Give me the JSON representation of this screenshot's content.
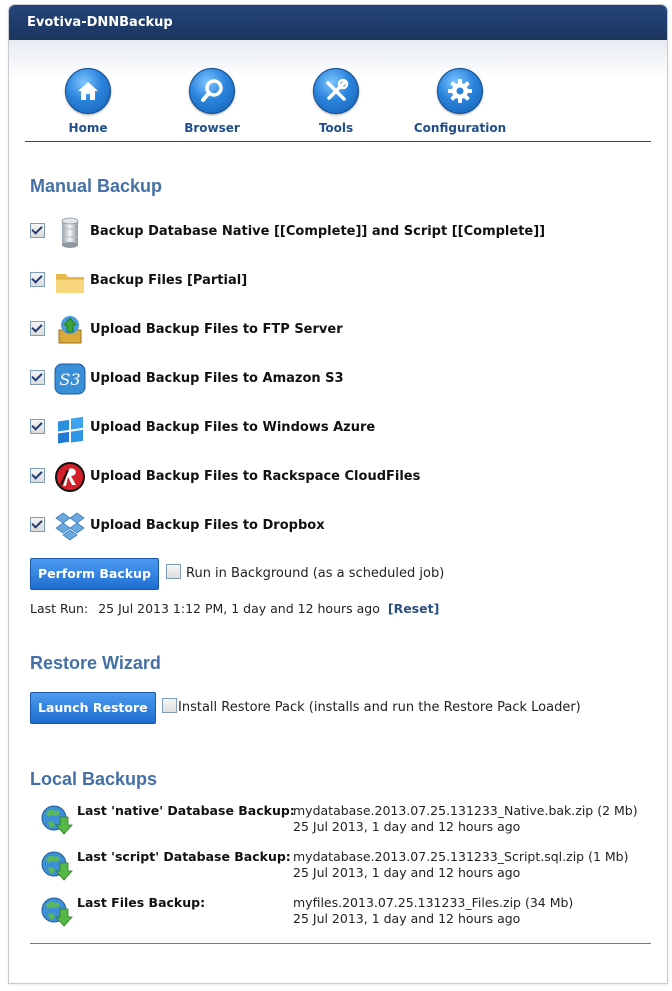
{
  "window": {
    "title": "Evotiva-DNNBackup"
  },
  "nav": [
    {
      "label": "Home",
      "icon": "home-icon"
    },
    {
      "label": "Browser",
      "icon": "magnifier-icon"
    },
    {
      "label": "Tools",
      "icon": "tools-icon"
    },
    {
      "label": "Configuration",
      "icon": "gear-icon"
    }
  ],
  "manual_backup": {
    "title": "Manual Backup",
    "options": [
      {
        "label": "Backup Database Native [[Complete]] and Script [[Complete]]",
        "checked": true,
        "icon": "database-icon"
      },
      {
        "label": "Backup Files [Partial]",
        "checked": true,
        "icon": "folder-icon"
      },
      {
        "label": "Upload Backup Files to FTP Server",
        "checked": true,
        "icon": "ftp-upload-icon"
      },
      {
        "label": "Upload Backup Files to Amazon S3",
        "checked": true,
        "icon": "amazon-s3-icon"
      },
      {
        "label": "Upload Backup Files to Windows Azure",
        "checked": true,
        "icon": "windows-azure-icon"
      },
      {
        "label": "Upload Backup Files to Rackspace CloudFiles",
        "checked": true,
        "icon": "rackspace-icon"
      },
      {
        "label": "Upload Backup Files to Dropbox",
        "checked": true,
        "icon": "dropbox-icon"
      }
    ],
    "perform_button": "Perform Backup",
    "run_background_label": "Run in Background (as a scheduled job)",
    "run_background_checked": false,
    "last_run_label": "Last Run:",
    "last_run_value": "25 Jul 2013 1:12 PM, 1 day and 12 hours ago",
    "reset_label": "[Reset]"
  },
  "restore": {
    "title": "Restore Wizard",
    "launch_button": "Launch Restore",
    "install_pack_label": "Install Restore Pack (installs and run the Restore Pack Loader)",
    "install_pack_checked": false
  },
  "local_backups": {
    "title": "Local Backups",
    "items": [
      {
        "label": "Last 'native' Database Backup:",
        "file": "mydatabase.2013.07.25.131233_Native.bak.zip (2 Mb)",
        "when": "25 Jul 2013, 1 day and 12 hours ago"
      },
      {
        "label": "Last 'script' Database Backup:",
        "file": "mydatabase.2013.07.25.131233_Script.sql.zip (1 Mb)",
        "when": "25 Jul 2013, 1 day and 12 hours ago"
      },
      {
        "label": "Last Files Backup:",
        "file": "myfiles.2013.07.25.131233_Files.zip (34 Mb)",
        "when": "25 Jul 2013, 1 day and 12 hours ago"
      }
    ]
  },
  "colors": {
    "title_bar": "#1b355f",
    "section_title": "#4470a5",
    "button": "#1f6dd0",
    "link": "#2a4f85"
  }
}
